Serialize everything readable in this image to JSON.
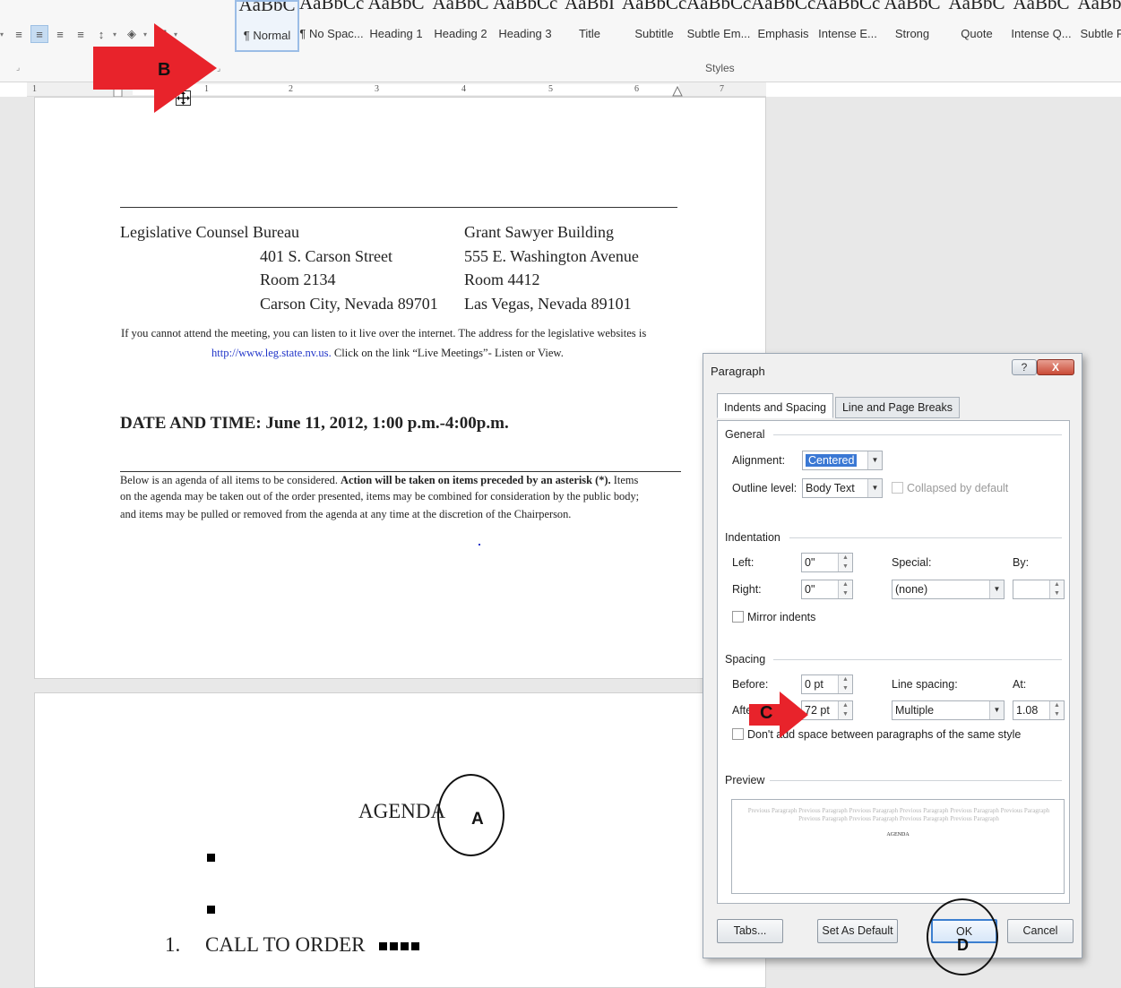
{
  "ribbon": {
    "styles": [
      {
        "sample": "AaBbC",
        "label": "¶ Normal",
        "selected": true
      },
      {
        "sample": "AaBbCcDc",
        "label": "¶ No Spac...",
        "selected": false
      },
      {
        "sample": "AaBbC",
        "label": "Heading 1",
        "selected": false
      },
      {
        "sample": "AaBbC",
        "label": "Heading 2",
        "selected": false
      },
      {
        "sample": "AaBbCcD",
        "label": "Heading 3",
        "selected": false
      },
      {
        "sample": "AaBbI",
        "label": "Title",
        "selected": false
      },
      {
        "sample": "AaBbCcC",
        "label": "Subtitle",
        "selected": false
      },
      {
        "sample": "AaBbCcI",
        "label": "Subtle Em...",
        "selected": false
      },
      {
        "sample": "AaBbCcI",
        "label": "Emphasis",
        "selected": false
      },
      {
        "sample": "AaBbCcI",
        "label": "Intense E...",
        "selected": false
      },
      {
        "sample": "AaBbC",
        "label": "Strong",
        "selected": false
      },
      {
        "sample": "AaBbC",
        "label": "Quote",
        "selected": false
      },
      {
        "sample": "AaBbC",
        "label": "Intense Q...",
        "selected": false
      },
      {
        "sample": "AaBbC",
        "label": "Subtle Re",
        "selected": false
      }
    ],
    "styles_group_label": "Styles"
  },
  "ruler": {
    "numbers": [
      "1",
      "1",
      "2",
      "3",
      "4",
      "5",
      "6",
      "7"
    ]
  },
  "document": {
    "left_address": [
      "Legislative Counsel Bureau",
      "401 S. Carson Street",
      "Room 2134",
      "Carson City, Nevada 89701"
    ],
    "right_address": [
      "Grant Sawyer Building",
      "555 E. Washington Avenue",
      "Room 4412",
      "Las Vegas, Nevada 89101"
    ],
    "notice_line1": "If you cannot attend the meeting, you can listen to it live over the internet. The address for the legislative websites is",
    "notice_link": "http://www.leg.state.nv.us.",
    "notice_line2_rest": " Click on the link “Live Meetings”- Listen or View.",
    "date_time": "DATE AND TIME:  June 11, 2012, 1:00 p.m.-4:00p.m.",
    "agenda_intro_plain1": "Below is an agenda of all items to be considered. ",
    "agenda_intro_bold": "Action will be taken on items preceded by an asterisk (*).",
    "agenda_intro_plain2": " Items",
    "agenda_intro_line2": "on the agenda may be taken out of the order presented, items may be combined for consideration by the public body;",
    "agenda_intro_line3": "and items may be pulled or removed from the agenda at any time at the discretion of the Chairperson.",
    "agenda_title": "AGENDA",
    "call_to_order_number": "1.",
    "call_to_order": "CALL TO ORDER"
  },
  "annotations": {
    "a": "A",
    "b": "B",
    "c": "C",
    "d": "D",
    "arrow_color": "#e8232b"
  },
  "dialog": {
    "title": "Paragraph",
    "help": "?",
    "close": "X",
    "tabs": [
      "Indents and Spacing",
      "Line and Page Breaks"
    ],
    "general": {
      "section": "General",
      "alignment_label": "Alignment:",
      "alignment_value": "Centered",
      "outline_label": "Outline level:",
      "outline_value": "Body Text",
      "collapsed_label": "Collapsed by default"
    },
    "indentation": {
      "section": "Indentation",
      "left_label": "Left:",
      "left_value": "0\"",
      "right_label": "Right:",
      "right_value": "0\"",
      "special_label": "Special:",
      "special_value": "(none)",
      "by_label": "By:",
      "by_value": "",
      "mirror_label": "Mirror indents"
    },
    "spacing": {
      "section": "Spacing",
      "before_label": "Before:",
      "before_value": "0 pt",
      "after_label": "After:",
      "after_value": "72 pt",
      "line_spacing_label": "Line spacing:",
      "line_spacing_value": "Multiple",
      "at_label": "At:",
      "at_value": "1.08",
      "dont_add_label": "Don't add space between paragraphs of the same style"
    },
    "preview": {
      "section": "Preview",
      "previous_text": "Previous Paragraph Previous Paragraph Previous Paragraph Previous Paragraph Previous Paragraph Previous Paragraph Previous Paragraph Previous Paragraph Previous Paragraph Previous Paragraph",
      "sample": "AGENDA"
    },
    "buttons": {
      "tabs": "Tabs...",
      "set_default": "Set As Default",
      "ok": "OK",
      "cancel": "Cancel"
    }
  }
}
